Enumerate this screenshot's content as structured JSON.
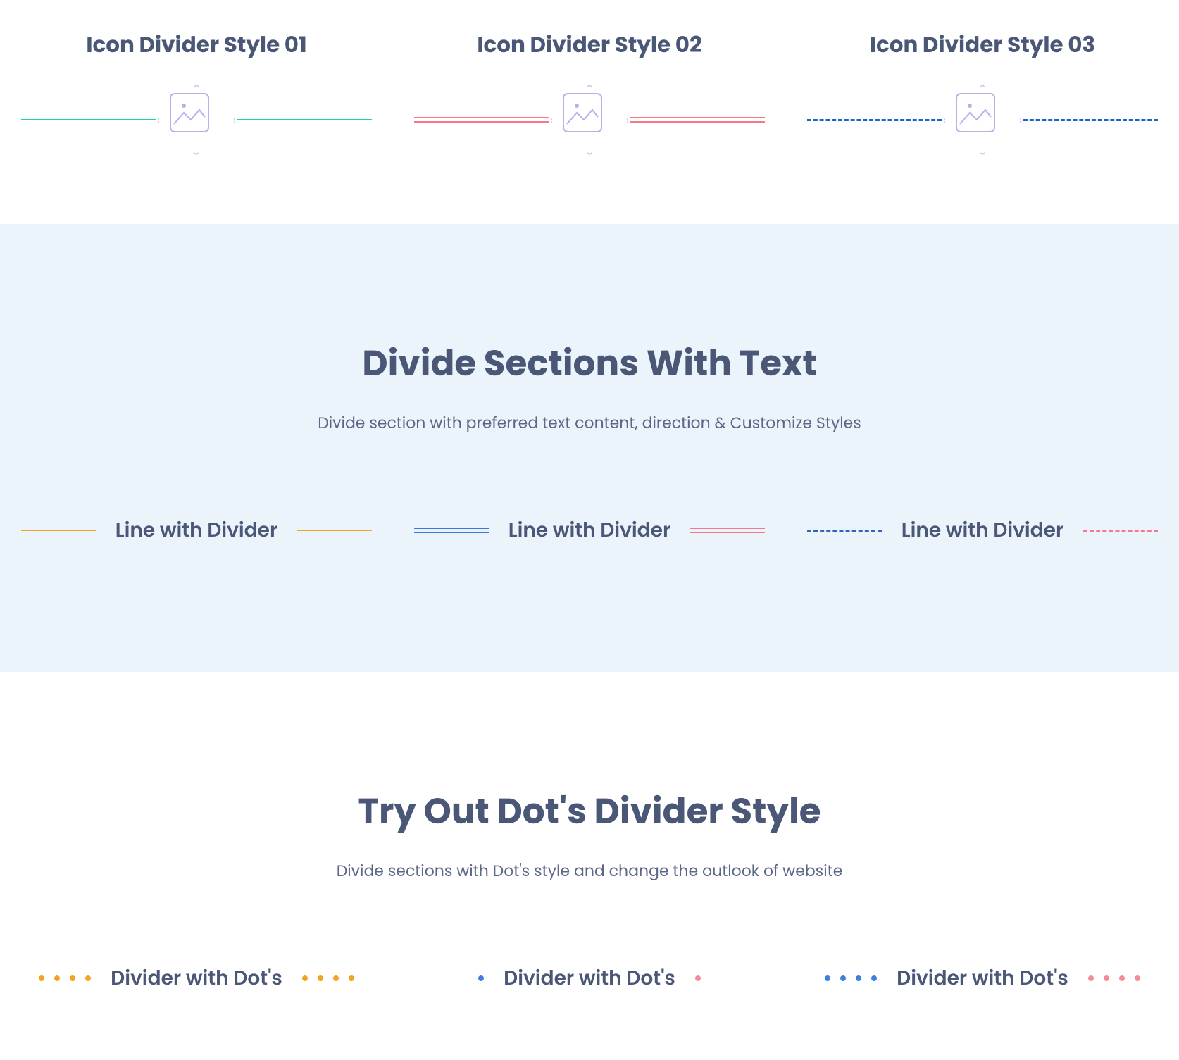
{
  "iconSection": {
    "items": [
      {
        "title": "Icon Divider Style 01"
      },
      {
        "title": "Icon Divider Style 02"
      },
      {
        "title": "Icon Divider Style 03"
      }
    ]
  },
  "textSection": {
    "title": "Divide Sections With Text",
    "subtitle": "Divide section with preferred text content, direction & Customize Styles",
    "items": [
      {
        "label": "Line with Divider"
      },
      {
        "label": "Line with Divider"
      },
      {
        "label": "Line with Divider"
      }
    ]
  },
  "dotsSection": {
    "title": "Try Out Dot's Divider Style",
    "subtitle": "Divide sections with Dot's style and change the outlook of website",
    "items": [
      {
        "label": "Divider with Dot's"
      },
      {
        "label": "Divider with Dot's"
      },
      {
        "label": "Divider with Dot's"
      }
    ]
  }
}
